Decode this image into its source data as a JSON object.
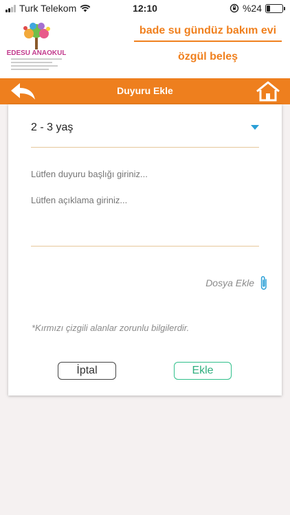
{
  "status_bar": {
    "carrier": "Turk Telekom",
    "time": "12:10",
    "battery_percent": "%24",
    "battery_level": 0.24
  },
  "header": {
    "logo_text": "BEDESU ANAOKULU",
    "school_name": "bade su gündüz bakım evi",
    "user_name": "özgül beleş"
  },
  "nav": {
    "title": "Duyuru Ekle",
    "back_icon": "back-arrow-icon",
    "home_icon": "home-icon"
  },
  "form": {
    "age_group_value": "2 - 3 yaş",
    "title_placeholder": "Lütfen duyuru başlığı giriniz...",
    "description_placeholder": "Lütfen açıklama giriniz...",
    "attach_label": "Dosya Ekle",
    "required_note": "*Kırmızı çizgili alanlar zorunlu bilgilerdir.",
    "cancel_label": "İptal",
    "add_label": "Ekle"
  },
  "colors": {
    "accent_orange": "#ee7f1e",
    "add_green": "#2fbf8a",
    "caret_blue": "#2a9fd6",
    "underline": "#e6c79a"
  }
}
